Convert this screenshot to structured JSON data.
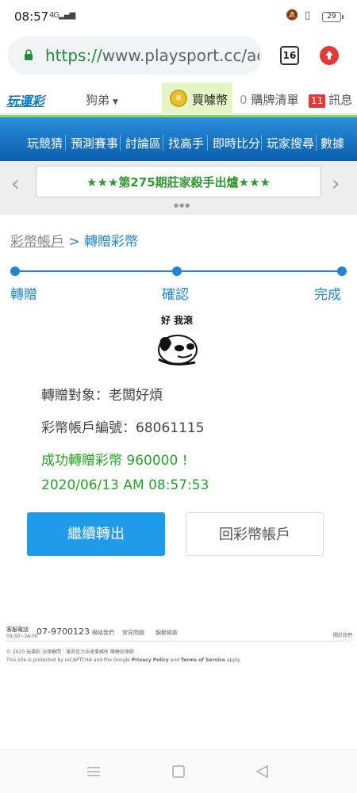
{
  "status_bar": {
    "time": "08:57",
    "signal": "4G",
    "battery": "29"
  },
  "browser": {
    "url_scheme": "https://",
    "url_rest": "www.playsport.cc/acc",
    "tab_count": "16"
  },
  "site": {
    "logo": "玩運彩",
    "user": "狗弟",
    "buy_coins": "買噱幣",
    "coin_label": "噱",
    "cart_count": "0",
    "cart_label": "購牌清單",
    "msg_count": "11",
    "msg_label": "訊息"
  },
  "nav": [
    "玩競猜",
    "預測賽事",
    "討論區",
    "找高手",
    "即時比分",
    "玩家搜尋",
    "數據"
  ],
  "banner": {
    "text": "★★★第275期莊家殺手出爐★★★"
  },
  "breadcrumb": {
    "parent": "彩幣帳戶",
    "sep": " > ",
    "current": "轉贈彩幣"
  },
  "steps": [
    "轉贈",
    "確認",
    "完成"
  ],
  "meme_caption": "好 我滾",
  "transfer": {
    "recipient_label": "轉贈對象：",
    "recipient": "老闆好煩",
    "account_label": "彩幣帳戶編號：",
    "account": "68061115",
    "success": "成功轉贈彩幣 960000 !",
    "datetime": "2020/06/13 AM 08:57:53"
  },
  "buttons": {
    "continue": "繼續轉出",
    "back": "回彩幣帳戶"
  },
  "footer": {
    "service_label": "客服電話",
    "service_hours": "09:30~24:00",
    "phone": "07-9700123",
    "links": [
      "聯絡我們",
      "常見問題",
      "服務條款"
    ],
    "close": "關於我們",
    "copyright": "© 2020 玩運彩 法律顧問｜漢英信力法律事務所 陳曉宏律師",
    "recaptcha_pre": "This site is protected by reCAPTCHA and the Google ",
    "privacy": "Privacy Policy",
    "and": " and ",
    "terms": "Terms of Service",
    "apply": " apply."
  }
}
